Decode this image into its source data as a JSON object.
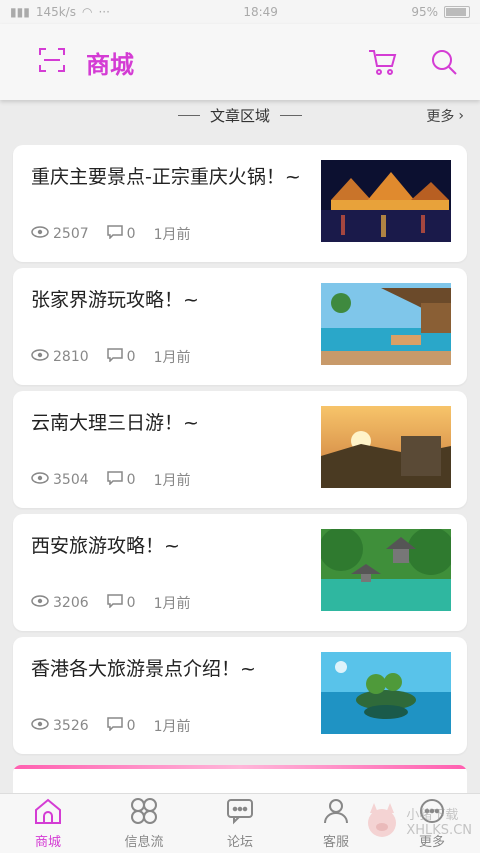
{
  "status": {
    "signal": "145k/s",
    "time": "18:49",
    "battery": "95%"
  },
  "header": {
    "title": "商城"
  },
  "section": {
    "title": "文章区域",
    "more": "更多"
  },
  "articles": [
    {
      "title": "重庆主要景点-正宗重庆火锅！~",
      "views": "2507",
      "comments": "0",
      "time": "1月前",
      "thumb": "chongqing-night-river-photo"
    },
    {
      "title": "张家界游玩攻略！~",
      "views": "2810",
      "comments": "0",
      "time": "1月前",
      "thumb": "resort-pool-photo"
    },
    {
      "title": "云南大理三日游！~",
      "views": "3504",
      "comments": "0",
      "time": "1月前",
      "thumb": "dali-sunset-photo"
    },
    {
      "title": "西安旅游攻略！~",
      "views": "3206",
      "comments": "0",
      "time": "1月前",
      "thumb": "pagoda-lake-photo"
    },
    {
      "title": "香港各大旅游景点介绍！~",
      "views": "3526",
      "comments": "0",
      "time": "1月前",
      "thumb": "turtle-island-photo"
    }
  ],
  "tabs": [
    {
      "label": "商城",
      "icon": "shop-icon"
    },
    {
      "label": "信息流",
      "icon": "feed-icon"
    },
    {
      "label": "论坛",
      "icon": "forum-icon"
    },
    {
      "label": "客服",
      "icon": "service-icon"
    },
    {
      "label": "更多",
      "icon": "more-icon"
    }
  ],
  "watermark": {
    "line1": "小猪下载",
    "line2": "XHLKS.CN"
  },
  "colors": {
    "accent": "#d43cd4",
    "background": "#ececec",
    "card": "#ffffff"
  }
}
